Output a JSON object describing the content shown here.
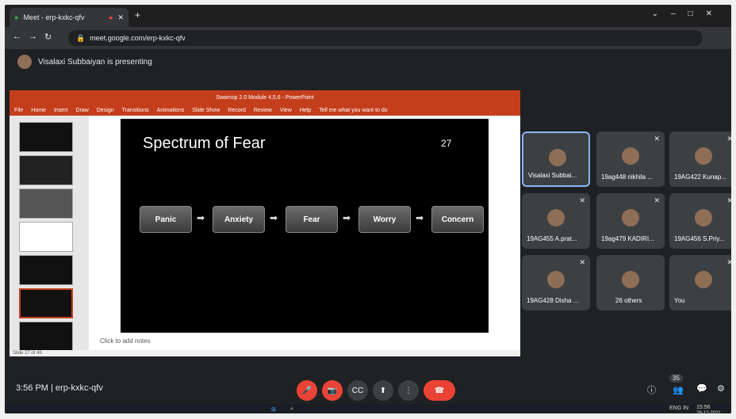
{
  "browser": {
    "tab_title": "Meet - erp-kxkc-qfv",
    "url": "meet.google.com/erp-kxkc-qfv"
  },
  "presenting": "Visalaxi Subbaiyan is presenting",
  "ppt": {
    "title": "Swamop 2.0 Module 4,5,6 - PowerPoint",
    "menu": [
      "File",
      "Home",
      "Insert",
      "Draw",
      "Design",
      "Transitions",
      "Animations",
      "Slide Show",
      "Record",
      "Review",
      "View",
      "Help",
      "Tell me what you want to do"
    ],
    "status": "Slide 27 of 46",
    "notes": "Click to add notes"
  },
  "slide": {
    "title": "Spectrum of Fear",
    "number": "27",
    "steps": [
      "Panic",
      "Anxiety",
      "Fear",
      "Worry",
      "Concern"
    ]
  },
  "participants": [
    {
      "name": "Visalaxi Subbai..."
    },
    {
      "name": "19ag448 nikhila ..."
    },
    {
      "name": "19AG422 Kunap..."
    },
    {
      "name": "19AG455 A.prat..."
    },
    {
      "name": "19ag479 KADIRI..."
    },
    {
      "name": "19AG456 S.Priy..."
    },
    {
      "name": "19AG428 Disha ..."
    },
    {
      "name": "26 others"
    },
    {
      "name": "You"
    }
  ],
  "meeting": {
    "time_code": "3:56 PM  |  erp-kxkc-qfv",
    "count": "35"
  },
  "taskbar": {
    "lang": "ENG IN",
    "time": "15:56",
    "date": "29-12-2021"
  }
}
